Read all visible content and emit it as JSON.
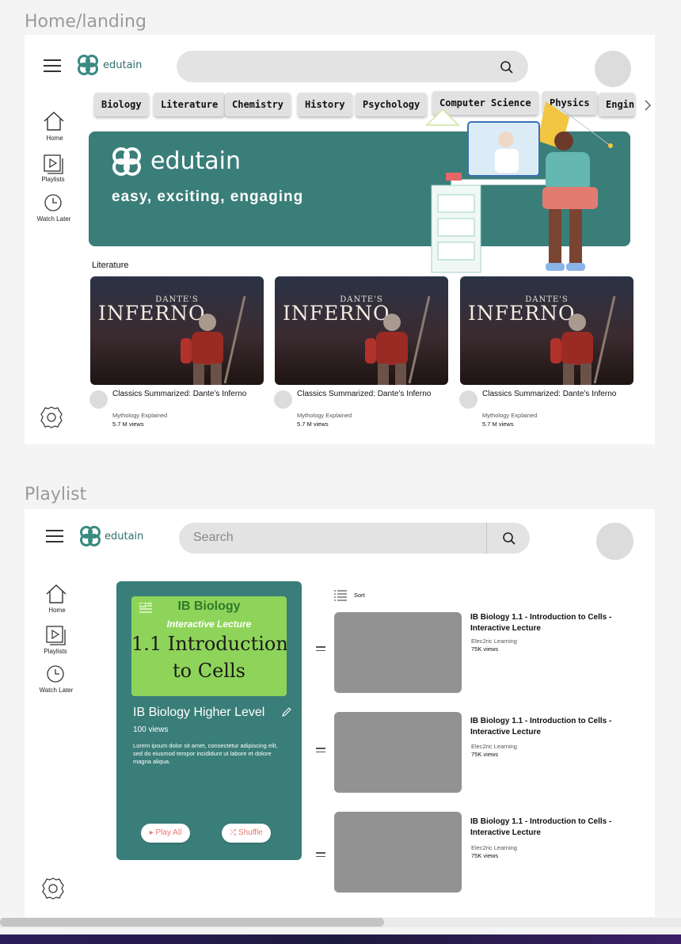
{
  "home_frame_label": "Home/landing",
  "playlist_frame_label": "Playlist",
  "brand": "edutain",
  "nav": [
    {
      "label": "Home",
      "icon": "home-icon"
    },
    {
      "label": "Playlists",
      "icon": "playlist-icon"
    },
    {
      "label": "Watch Later",
      "icon": "clock-icon"
    }
  ],
  "categories": [
    "Biology",
    "Literature",
    "Chemistry",
    "History",
    "Psychology",
    "Computer Science",
    "Physics",
    "Engin"
  ],
  "banner": {
    "logo": "edutain",
    "tagline": "easy, exciting, engaging"
  },
  "section_title": "Literature",
  "thumb_top": "DANTE'S",
  "thumb_main": "INFERNO",
  "videos": [
    {
      "title": "Classics Summarized: Dante’s Inferno",
      "channel": "Mythology Explained",
      "views": "5.7 M views"
    },
    {
      "title": "Classics Summarized: Dante’s Inferno",
      "channel": "Mythology Explained",
      "views": "5.7 M views"
    },
    {
      "title": "Classics Summarized: Dante’s Inferno",
      "channel": "Mythology Explained",
      "views": "5.7 M views"
    }
  ],
  "search_placeholder": "Search",
  "playlist": {
    "thumb_heading": "IB Biology",
    "thumb_sub": "Interactive Lecture",
    "thumb_line1": "1.1 Introduction",
    "thumb_line2": "to Cells",
    "title": "IB Biology Higher Level",
    "views": "100 views",
    "description": "Lorem ipsum dolor sit amet, consectetur adipiscing elit, sed do eiusmod tempor incididunt ut labore et dolore magna aliqua.",
    "play_all": "Play All",
    "shuffle": "Shuffle"
  },
  "sort_label": "Sort",
  "playlist_items": [
    {
      "title": "IB Biology 1.1 - Introduction to Cells - Interactive Lecture",
      "channel": "Elec2ric Learning",
      "views": "75K views"
    },
    {
      "title": "IB Biology 1.1 - Introduction to Cells - Interactive Lecture",
      "channel": "Elec2ric Learning",
      "views": "75K views"
    },
    {
      "title": "IB Biology 1.1 - Introduction to Cells - Interactive Lecture",
      "channel": "Elec2ric Learning",
      "views": "75K views"
    }
  ],
  "colors": {
    "teal": "#3a7e79",
    "accent": "#e8766e",
    "thumb_green": "#8fd45a"
  }
}
